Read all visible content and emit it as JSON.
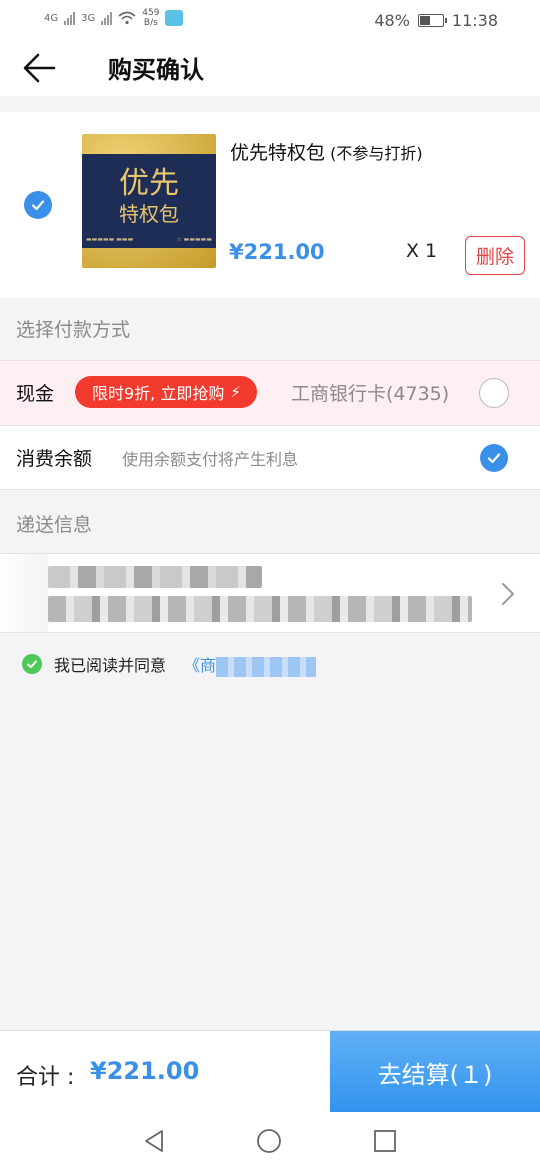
{
  "status_bar": {
    "net1": "4G",
    "net2": "3G",
    "speed_value": "459",
    "speed_unit": "B/s",
    "battery": "48%",
    "battery_level": 0.48,
    "time": "11:38"
  },
  "header": {
    "title": "购买确认",
    "back_icon": "arrow-left-icon"
  },
  "product": {
    "selected": true,
    "image_text_big": "优先",
    "image_text_small": "特权包",
    "name": "优先特权包",
    "name_note": " (不参与打折)",
    "price": "¥221.00",
    "quantity": "X 1",
    "delete_label": "删除"
  },
  "payment": {
    "section_label": "选择付款方式",
    "cash_label": "现金",
    "promo_label": "限时9折, 立即抢购",
    "promo_icon": "lightning-icon",
    "bank_label": "工商银行卡(4735)",
    "bank_selected": false,
    "balance_label": "消费余额",
    "balance_note": "使用余额支付将产生利息",
    "balance_selected": true
  },
  "delivery": {
    "section_label": "递送信息"
  },
  "agreement": {
    "checked": true,
    "text": "我已阅读并同意",
    "link_prefix": "《商"
  },
  "footer": {
    "total_label": "合计 :",
    "total_amount": "¥221.00",
    "checkout_label": "去结算(１)"
  },
  "colors": {
    "accent_blue": "#3a8fe8",
    "promo_red": "#f33a2e",
    "delete_red": "#e44545",
    "agree_green": "#4ec85b"
  }
}
